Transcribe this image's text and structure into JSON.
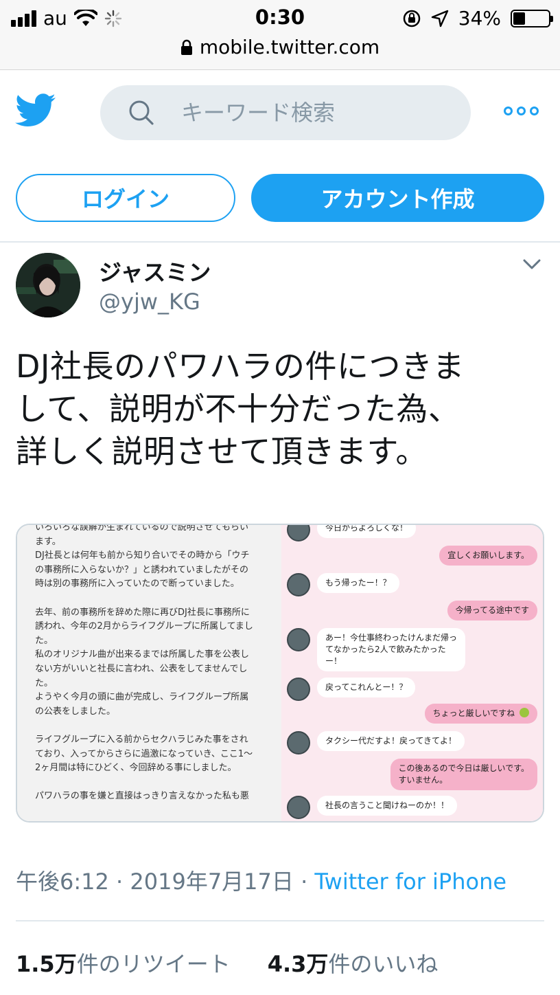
{
  "status_bar": {
    "carrier": "au",
    "time": "0:30",
    "battery_percent": "34%",
    "battery_level": 0.34,
    "url": "mobile.twitter.com"
  },
  "header": {
    "search_placeholder": "キーワード検索",
    "brand_color": "#1da1f2"
  },
  "auth": {
    "login_label": "ログイン",
    "signup_label": "アカウント作成"
  },
  "tweet": {
    "display_name": "ジャスミン",
    "handle": "@yjw_KG",
    "text_lines": [
      "DJ社長のパワハラの件につきま",
      "して、説明が不十分だった為、",
      "詳しく説明させて頂きます。"
    ],
    "timestamp": "午後6:12 · 2019年7月17日 · ",
    "source": "Twitter for iPhone",
    "retweets_count": "1.5万",
    "retweets_label": "件のリツイート",
    "likes_count": "4.3万",
    "likes_label": "件のいいね"
  },
  "media": {
    "left_lines": [
      "いろいろな誤解が生まれているので説明させてもらい",
      "ます。",
      "",
      "DJ社長とは何年も前から知り合いでその時から「ウチ",
      "の事務所に入らないか？」と誘われていましたがその",
      "時は別の事務所に入っていたので断っていました。",
      "",
      "去年、前の事務所を辞めた際に再びDJ社長に事務所に",
      "誘われ、今年の2月からライフグループに所属してまし",
      "た。",
      "私のオリジナル曲が出来るまでは所属した事を公表し",
      "ない方がいいと社長に言われ、公表をしてませんでし",
      "た。",
      "ようやく今月の頭に曲が完成し、ライフグループ所属",
      "の公表をしました。",
      "",
      "ライフグループに入る前からセクハラじみた事をされ",
      "ており、入ってからさらに過激になっていき、ここ1〜",
      "2ヶ月間は特にひどく、今回辞める事にしました。",
      "",
      "パワハラの事を嫌と直接はっきり言えなかった私も悪"
    ],
    "chat_in": [
      "今日からよろしくな！",
      "もう帰ったー！？",
      "あー！今仕事終わったけんまだ帰っ\nてなかったら2人で飲みたかった\nー！",
      "戻ってこれんとー！？",
      "タクシー代だすよ！戻ってきてよ！",
      "社長の言うこと聞けねーのか！！"
    ],
    "chat_out": [
      "宜しくお願いします。",
      "今帰ってる途中です",
      "ちょっと厳しいですね",
      "この後あるので今日は厳しいです。\nすいません。"
    ]
  }
}
